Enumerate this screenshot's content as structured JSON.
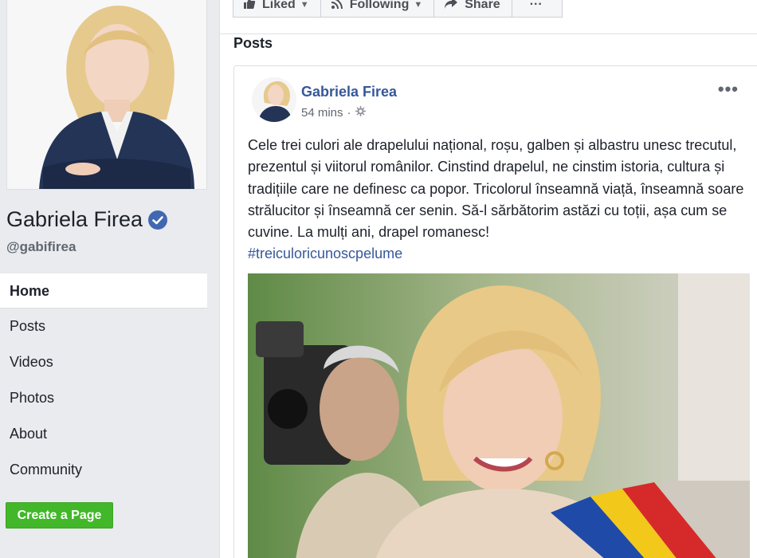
{
  "profile": {
    "name": "Gabriela Firea",
    "handle": "@gabifirea"
  },
  "nav": {
    "items": [
      {
        "label": "Home",
        "active": true
      },
      {
        "label": "Posts"
      },
      {
        "label": "Videos"
      },
      {
        "label": "Photos"
      },
      {
        "label": "About"
      },
      {
        "label": "Community"
      }
    ]
  },
  "create_page_label": "Create a Page",
  "actions": {
    "liked": "Liked",
    "following": "Following",
    "share": "Share",
    "more": "···"
  },
  "posts_header": "Posts",
  "post": {
    "author": "Gabriela Firea",
    "time": "54 mins",
    "text": "Cele trei culori ale drapelului național, roșu, galben și albastru unesc trecutul, prezentul și viitorul românilor. Cinstind drapelul, ne cinstim istoria, cultura și tradițiile care ne definesc ca popor. Tricolorul înseamnă viață, înseamnă soare strălucitor și înseamnă cer senin. Să-l sărbătorim astăzi cu toții, așa cum se cuvine. La mulți ani, drapel romanesc!",
    "hashtag": "#treiculoricunoscpelume",
    "options": "•••"
  },
  "colors": {
    "link": "#365899",
    "create_button": "#42b72a",
    "verified": "#4267b2"
  }
}
